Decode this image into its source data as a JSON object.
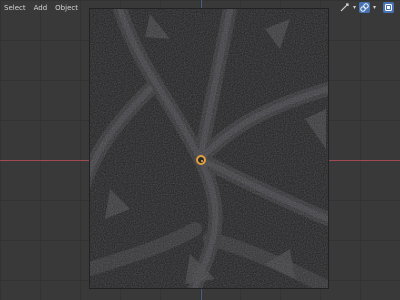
{
  "menu": {
    "items": [
      "Select",
      "Add",
      "Object"
    ]
  },
  "header_tools": {
    "icons": [
      "transform-pivot-icon",
      "overlay-icon",
      "shading-icon"
    ]
  },
  "colors": {
    "viewport_bg": "#393939",
    "x_axis": "#a04a52",
    "z_axis": "#4c6a9a",
    "origin": "#e0a040",
    "accent": "#4772b3"
  }
}
